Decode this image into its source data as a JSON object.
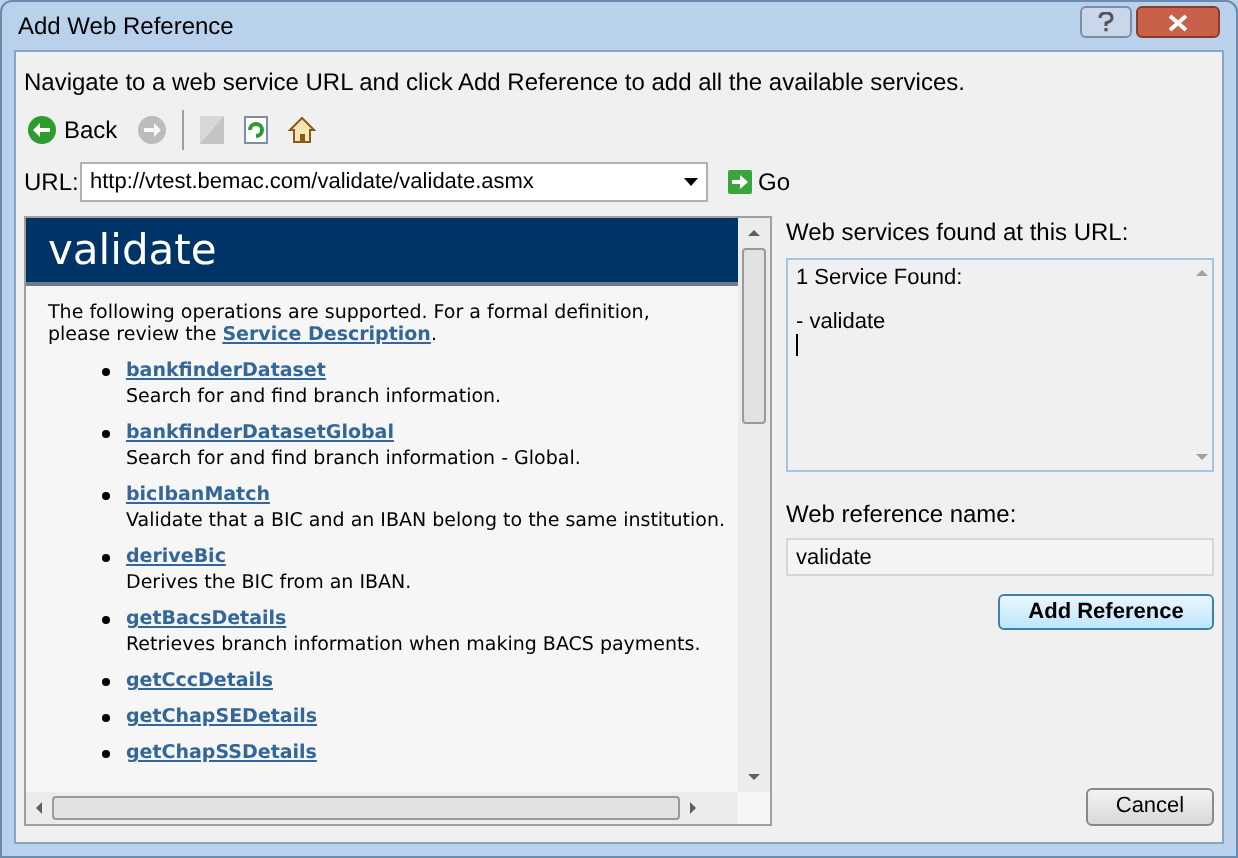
{
  "window": {
    "title": "Add Web Reference"
  },
  "instruction": "Navigate to a web service URL and click Add Reference to add all the available services.",
  "toolbar": [
    {
      "kind": "back",
      "label": "Back",
      "disabled": false
    },
    {
      "kind": "forward",
      "disabled": true
    },
    {
      "kind": "stop",
      "disabled": true
    },
    {
      "kind": "refresh",
      "disabled": false
    },
    {
      "kind": "home",
      "disabled": false
    }
  ],
  "url": {
    "label": "URL:",
    "value": "http://vtest.bemac.com/validate/validate.asmx",
    "go": "Go"
  },
  "browser": {
    "heading": "validate",
    "intro_before": "The following operations are supported. For a formal definition, please review the ",
    "intro_link": "Service Description",
    "intro_after": ".",
    "operations": [
      {
        "name": "bankfinderDataset",
        "description": "Search for and find branch information."
      },
      {
        "name": "bankfinderDatasetGlobal",
        "description": "Search for and find branch information - Global."
      },
      {
        "name": "bicIbanMatch",
        "description": "Validate that a BIC and an IBAN belong to the same institution."
      },
      {
        "name": "deriveBic",
        "description": "Derives the BIC from an IBAN."
      },
      {
        "name": "getBacsDetails",
        "description": "Retrieves branch information when making BACS payments."
      },
      {
        "name": "getCccDetails"
      },
      {
        "name": "getChapSEDetails"
      },
      {
        "name": "getChapSSDetails"
      }
    ]
  },
  "services": {
    "label": "Web services found at this URL:",
    "status": "1 Service Found:",
    "items": [
      "- validate"
    ]
  },
  "reference_name": {
    "label": "Web reference name:",
    "value": "validate"
  },
  "buttons": {
    "add": "Add Reference",
    "cancel": "Cancel"
  }
}
